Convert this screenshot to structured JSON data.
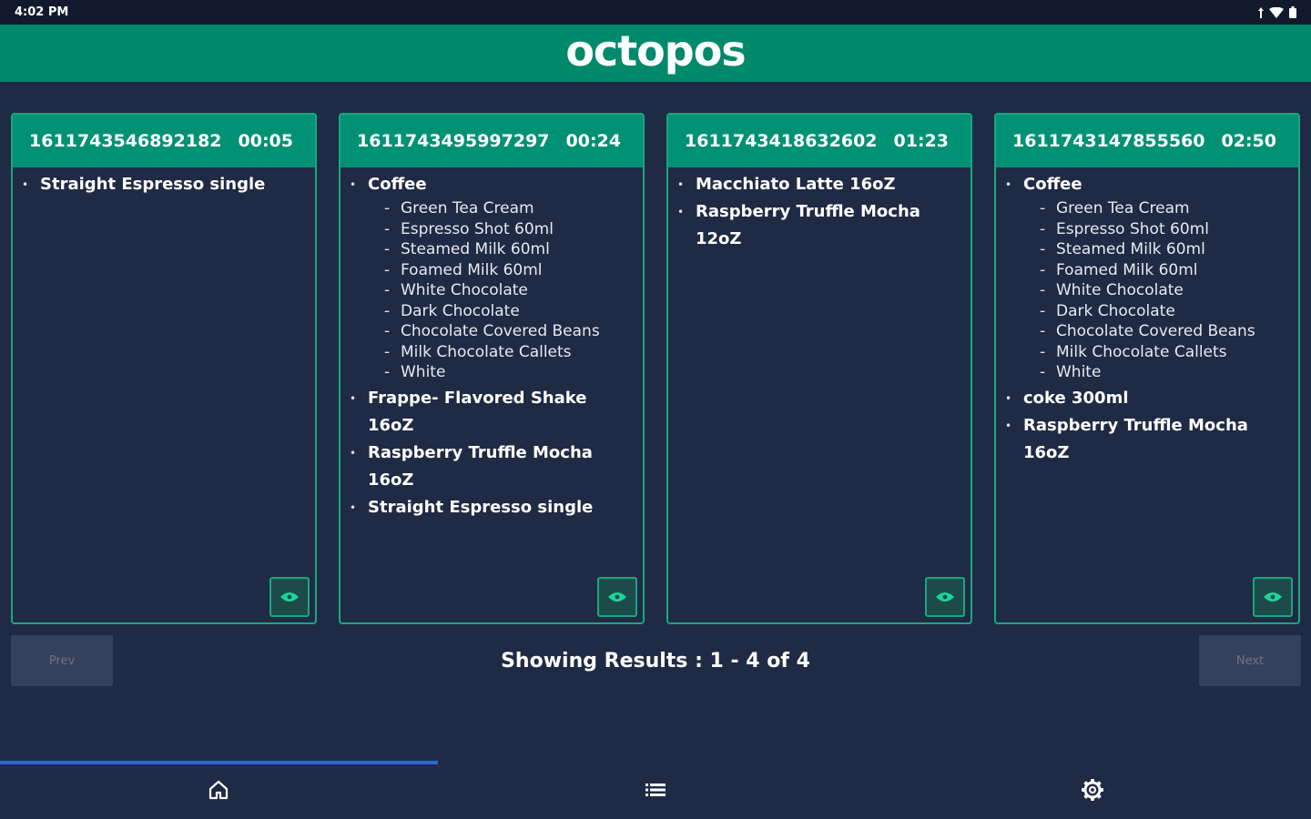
{
  "status_bar": {
    "time": "4:02 PM"
  },
  "header": {
    "brand": "octopos"
  },
  "colors": {
    "background": "#1f2a44",
    "header": "#00896b",
    "card_header": "#019174",
    "card_border": "#19a781",
    "nav_indicator": "#2f63e0"
  },
  "orders": [
    {
      "id": "1611743546892182",
      "elapsed": "00:05",
      "items": [
        {
          "name": "Straight Espresso single",
          "modifiers": []
        }
      ]
    },
    {
      "id": "1611743495997297",
      "elapsed": "00:24",
      "items": [
        {
          "name": "Coffee",
          "modifiers": [
            "Green Tea Cream",
            "Espresso Shot 60ml",
            "Steamed Milk 60ml",
            "Foamed Milk 60ml",
            "White Chocolate",
            "Dark Chocolate",
            "Chocolate Covered Beans",
            "Milk Chocolate Callets",
            "White"
          ]
        },
        {
          "name": "Frappe- Flavored Shake 16oZ",
          "modifiers": []
        },
        {
          "name": "Raspberry Truffle Mocha 16oZ",
          "modifiers": []
        },
        {
          "name": "Straight Espresso single",
          "modifiers": []
        }
      ]
    },
    {
      "id": "1611743418632602",
      "elapsed": "01:23",
      "items": [
        {
          "name": "Macchiato Latte 16oZ",
          "modifiers": []
        },
        {
          "name": "Raspberry Truffle Mocha 12oZ",
          "modifiers": []
        }
      ]
    },
    {
      "id": "1611743147855560",
      "elapsed": "02:50",
      "items": [
        {
          "name": "Coffee",
          "modifiers": [
            "Green Tea Cream",
            "Espresso Shot 60ml",
            "Steamed Milk 60ml",
            "Foamed Milk 60ml",
            "White Chocolate",
            "Dark Chocolate",
            "Chocolate Covered Beans",
            "Milk Chocolate Callets",
            "White"
          ]
        },
        {
          "name": "coke 300ml",
          "modifiers": []
        },
        {
          "name": "Raspberry Truffle Mocha 16oZ",
          "modifiers": []
        }
      ]
    }
  ],
  "pagination": {
    "prev_label": "Prev",
    "next_label": "Next",
    "results_text": "Showing Results : 1 - 4  of 4"
  },
  "bottom_nav": {
    "items": [
      {
        "icon": "home-icon",
        "active": true
      },
      {
        "icon": "list-icon",
        "active": false
      },
      {
        "icon": "settings-icon",
        "active": false
      }
    ]
  }
}
